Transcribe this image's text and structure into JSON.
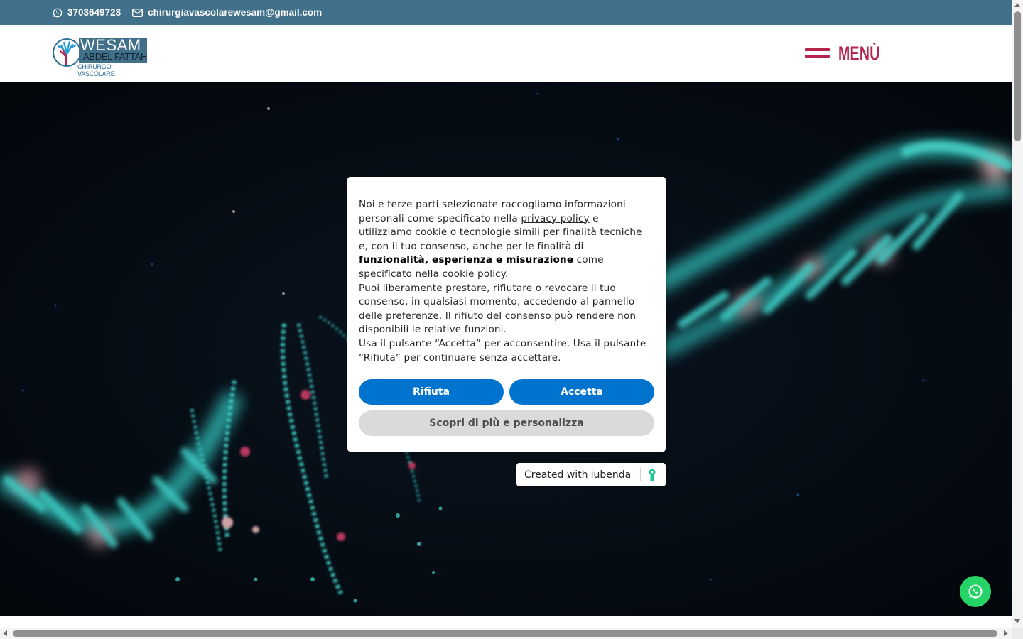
{
  "topbar": {
    "phone": "3703649728",
    "email": "chirurgiavascolarewesam@gmail.com"
  },
  "header": {
    "logo": {
      "name": "WESAM",
      "surname": "ABDEL FATTAH",
      "role": "CHIRURGO VASCOLARE"
    },
    "menu_label": "MENÙ"
  },
  "cookie_banner": {
    "text_1": "Noi e terze parti selezionate raccogliamo informazioni personali come specificato nella ",
    "privacy_link": "privacy policy",
    "text_2": " e utilizziamo cookie o tecnologie simili per finalità tecniche e, con il tuo consenso, anche per le finalità di ",
    "bold_purposes": "funzionalità, esperienza e misurazione",
    "text_3": " come specificato nella ",
    "cookie_link": "cookie policy",
    "text_4": ".",
    "paragraph_2": "Puoi liberamente prestare, rifiutare o revocare il tuo consenso, in qualsiasi momento, accedendo al pannello delle preferenze. Il rifiuto del consenso può rendere non disponibili le relative funzioni.",
    "paragraph_3": "Usa il pulsante “Accetta” per acconsentire. Usa il pulsante “Rifiuta” per continuare senza accettare.",
    "reject_label": "Rifiuta",
    "accept_label": "Accetta",
    "customize_label": "Scopri di più e personalizza"
  },
  "iubenda_badge": {
    "prefix": "Created with",
    "link": "iubenda"
  },
  "icons": {
    "whatsapp": "whatsapp-icon",
    "email": "envelope-icon",
    "menu": "hamburger-icon",
    "key": "keyhole-icon"
  },
  "colors": {
    "topbar": "#41708a",
    "brand_accent": "#b5254e",
    "button_blue": "#0073ce",
    "whatsapp_green": "#25d366"
  }
}
